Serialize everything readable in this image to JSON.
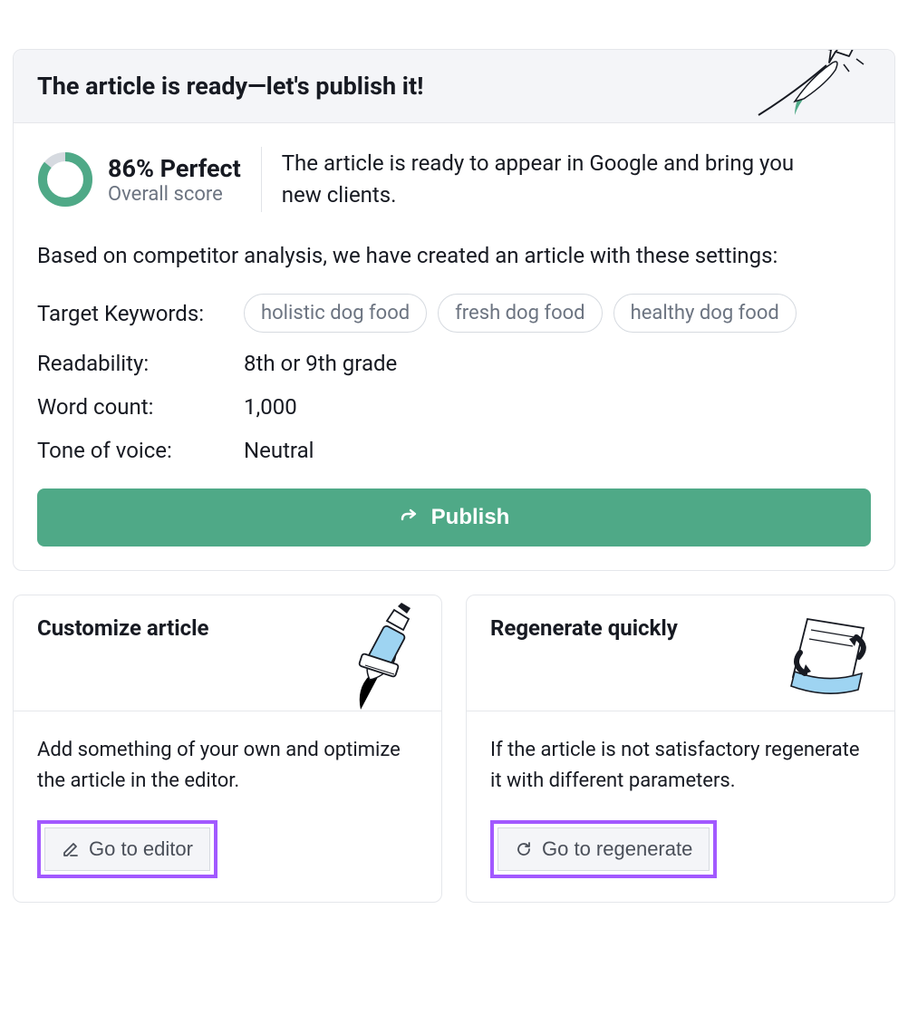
{
  "main": {
    "title": "The article is ready—let's publish it!",
    "score_value": "86% Perfect",
    "score_label": "Overall score",
    "score_percent": 86,
    "score_desc": "The article is ready to appear in Google and bring you new clients.",
    "intro": "Based on competitor analysis, we have created an article with these settings:",
    "keywords_label": "Target Keywords:",
    "keywords": [
      "holistic dog food",
      "fresh dog food",
      "healthy dog food"
    ],
    "readability_label": "Readability:",
    "readability_value": "8th or 9th grade",
    "wordcount_label": "Word count:",
    "wordcount_value": "1,000",
    "tone_label": "Tone of voice:",
    "tone_value": "Neutral",
    "publish_label": "Publish"
  },
  "customize": {
    "title": "Customize article",
    "desc": "Add something of your own and optimize the article in the editor.",
    "button": "Go to editor"
  },
  "regenerate": {
    "title": "Regenerate quickly",
    "desc": "If the article is not satisfactory regenerate it with different parameters.",
    "button": "Go to regenerate"
  }
}
